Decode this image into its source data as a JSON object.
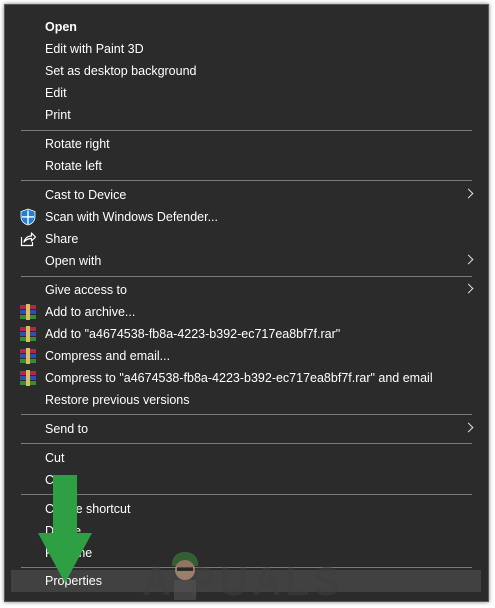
{
  "menu": {
    "open": "Open",
    "edit_paint3d": "Edit with Paint 3D",
    "set_desktop_bg": "Set as desktop background",
    "edit": "Edit",
    "print": "Print",
    "rotate_right": "Rotate right",
    "rotate_left": "Rotate left",
    "cast_to_device": "Cast to Device",
    "scan_defender": "Scan with Windows Defender...",
    "share": "Share",
    "open_with": "Open with",
    "give_access": "Give access to",
    "add_archive": "Add to archive...",
    "add_to_rar": "Add to \"a4674538-fb8a-4223-b392-ec717ea8bf7f.rar\"",
    "compress_email": "Compress and email...",
    "compress_to_rar_email": "Compress to \"a4674538-fb8a-4223-b392-ec717ea8bf7f.rar\" and email",
    "restore_versions": "Restore previous versions",
    "send_to": "Send to",
    "cut": "Cut",
    "copy": "Copy",
    "create_shortcut": "Create shortcut",
    "delete": "Delete",
    "rename": "Rename",
    "properties": "Properties"
  },
  "watermark": {
    "text": "A  PUALS"
  },
  "colors": {
    "menu_bg": "#2b2b2b",
    "highlight": "#414141",
    "arrow": "#2ea043",
    "separator": "#7a7a7a"
  },
  "icons": [
    "defender-shield-icon",
    "share-icon",
    "winrar-icon",
    "chevron-right-icon",
    "down-arrow-icon"
  ]
}
